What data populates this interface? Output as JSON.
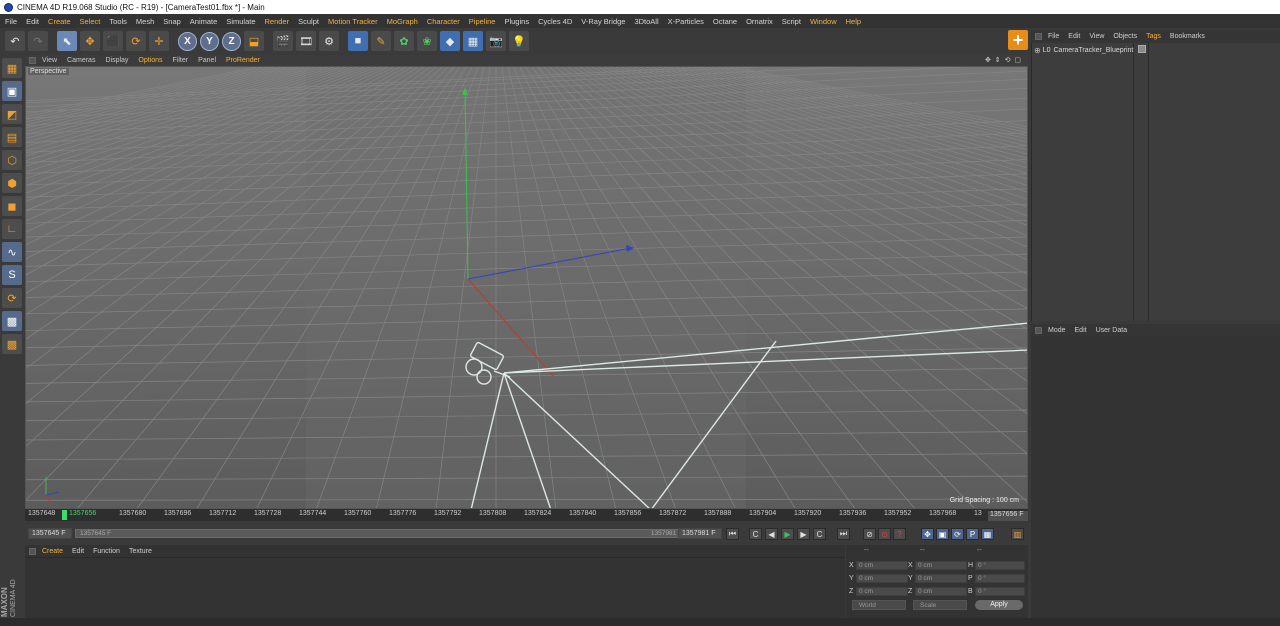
{
  "title": "CINEMA 4D R19.068 Studio (RC - R19) - [CameraTest01.fbx *] - Main",
  "menu": [
    "File",
    "Edit",
    "Create",
    "Select",
    "Tools",
    "Mesh",
    "Snap",
    "Animate",
    "Simulate",
    "Render",
    "Sculpt",
    "Motion Tracker",
    "MoGraph",
    "Character",
    "Pipeline",
    "Plugins",
    "Cycles 4D",
    "V-Ray Bridge",
    "3DtoAll",
    "X-Particles",
    "Octane",
    "Ornatrix",
    "Script",
    "Window",
    "Help"
  ],
  "toolbar": {
    "undo": "↶",
    "redo": "↷",
    "select": "⬉",
    "move": "✥",
    "scale": "⬛",
    "rotate": "⟳",
    "create": "✛",
    "x": "X",
    "y": "Y",
    "z": "Z",
    "coord": "⬓",
    "render_view": "🎬",
    "render_pv": "🎞",
    "render_settings": "⚙",
    "cube": "■",
    "pen": "✎",
    "gen": "✿",
    "deform": "❀",
    "scene": "◆",
    "floor": "▦",
    "camera": "📷",
    "light": "💡",
    "plus": "+"
  },
  "viewport": {
    "menu": [
      "View",
      "Cameras",
      "Display",
      "Options",
      "Filter",
      "Panel",
      "ProRender"
    ],
    "label": "Perspective",
    "grid_spacing": "Grid Spacing : 100 cm",
    "nav": "✥ ⇕ ⟲ ▢"
  },
  "timeline": {
    "ticks": [
      "1357648",
      "1357656",
      "1357680",
      "1357696",
      "1357712",
      "1357728",
      "1357744",
      "1357760",
      "1357776",
      "1357792",
      "1357808",
      "1357824",
      "1357840",
      "1357856",
      "1357872",
      "1357888",
      "1357904",
      "1357920",
      "1357936",
      "1357952",
      "1357968",
      "13"
    ],
    "current_frame": "1357656 F",
    "start_field": "1357645 F",
    "range_start": "1357645 F",
    "range_end": "1357981 F",
    "end_field": "1357981 F"
  },
  "material": {
    "menu": [
      "Create",
      "Edit",
      "Function",
      "Texture"
    ]
  },
  "coordinates": {
    "headers": [
      "--",
      "--",
      "--"
    ],
    "rows": [
      {
        "a": "X",
        "av": "0 cm",
        "b": "X",
        "bv": "0 cm",
        "c": "H",
        "cv": "0 °"
      },
      {
        "a": "Y",
        "av": "0 cm",
        "b": "Y",
        "bv": "0 cm",
        "c": "P",
        "cv": "0 °"
      },
      {
        "a": "Z",
        "av": "0 cm",
        "b": "Z",
        "bv": "0 cm",
        "c": "B",
        "cv": "0 °"
      }
    ],
    "world": "World",
    "scale": "Scale",
    "apply": "Apply"
  },
  "objects": {
    "menu": [
      "File",
      "Edit",
      "View",
      "Objects",
      "Tags",
      "Bookmarks"
    ],
    "items": [
      {
        "layer": "L0",
        "name": "CameraTracker_Blueprint"
      }
    ]
  },
  "attributes": {
    "menu": [
      "Mode",
      "Edit",
      "User Data"
    ]
  },
  "brand": {
    "maxon": "MAXON",
    "c4d": "CINEMA 4D"
  }
}
